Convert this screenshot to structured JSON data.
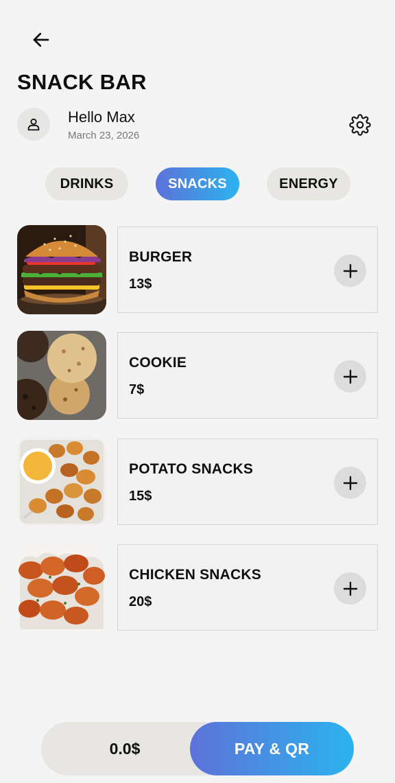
{
  "app": {
    "title": "SNACK BAR",
    "back_icon": "arrow-left-icon"
  },
  "user": {
    "greeting": "Hello Max",
    "date": "March 23, 2026",
    "avatar_icon": "user-icon",
    "settings_icon": "gear-icon"
  },
  "tabs": [
    {
      "label": "DRINKS",
      "active": false
    },
    {
      "label": "SNACKS",
      "active": true
    },
    {
      "label": "ENERGY",
      "active": false
    }
  ],
  "items": [
    {
      "name": "BURGER",
      "price": "13$",
      "image": "burger"
    },
    {
      "name": "COOKIE",
      "price": "7$",
      "image": "cookies"
    },
    {
      "name": "POTATO SNACKS",
      "price": "15$",
      "image": "potato-chips-with-dip"
    },
    {
      "name": "CHICKEN SNACKS",
      "price": "20$",
      "image": "fried-chicken-nuggets"
    }
  ],
  "cart": {
    "total": "0.0$",
    "pay_label": "PAY & QR"
  },
  "colors": {
    "accent_start": "#5d72d9",
    "accent_end": "#2cb3ee",
    "tab_bg": "#e7e6e2",
    "background": "#f4f4f4"
  }
}
